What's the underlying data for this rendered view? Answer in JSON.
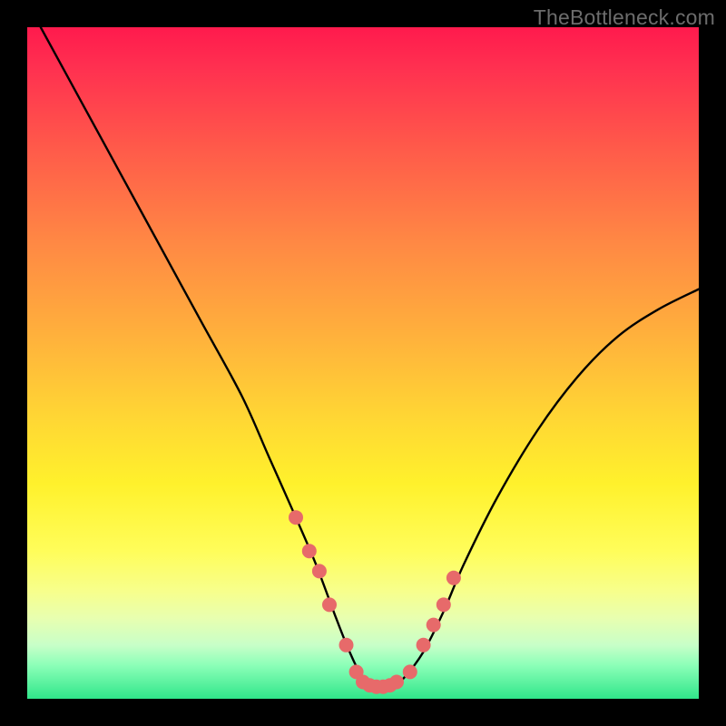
{
  "watermark": "TheBottleneck.com",
  "chart_data": {
    "type": "line",
    "title": "",
    "xlabel": "",
    "ylabel": "",
    "xlim": [
      0,
      100
    ],
    "ylim": [
      0,
      100
    ],
    "series": [
      {
        "name": "curve",
        "x": [
          2,
          8,
          14,
          20,
          26,
          32,
          36,
          40,
          43,
          46,
          48,
          50,
          52,
          54,
          56,
          59,
          62,
          65,
          70,
          76,
          82,
          88,
          94,
          100
        ],
        "values": [
          100,
          89,
          78,
          67,
          56,
          45,
          36,
          27,
          20,
          12,
          7,
          3,
          1.5,
          1.5,
          3,
          7,
          13,
          20,
          30,
          40,
          48,
          54,
          58,
          61
        ]
      }
    ],
    "markers": {
      "name": "highlight-dots",
      "color": "#e76a6a",
      "x": [
        40,
        42,
        43.5,
        45,
        47.5,
        49,
        50,
        51,
        52,
        53,
        54,
        55,
        57,
        59,
        60.5,
        62,
        63.5
      ],
      "values": [
        27,
        22,
        19,
        14,
        8,
        4,
        2.5,
        2,
        1.8,
        1.8,
        2,
        2.5,
        4,
        8,
        11,
        14,
        18
      ]
    },
    "gradient_bands": [
      {
        "color": "#f8ff70",
        "y0": 78,
        "y1": 81
      },
      {
        "color": "#eaffa0",
        "y0": 81,
        "y1": 86
      },
      {
        "color": "#d0ffc0",
        "y0": 86,
        "y1": 90
      },
      {
        "color": "#a0ffc8",
        "y0": 90,
        "y1": 93
      },
      {
        "color": "#70f7b0",
        "y0": 93,
        "y1": 96
      },
      {
        "color": "#30e68a",
        "y0": 96,
        "y1": 100
      }
    ]
  }
}
